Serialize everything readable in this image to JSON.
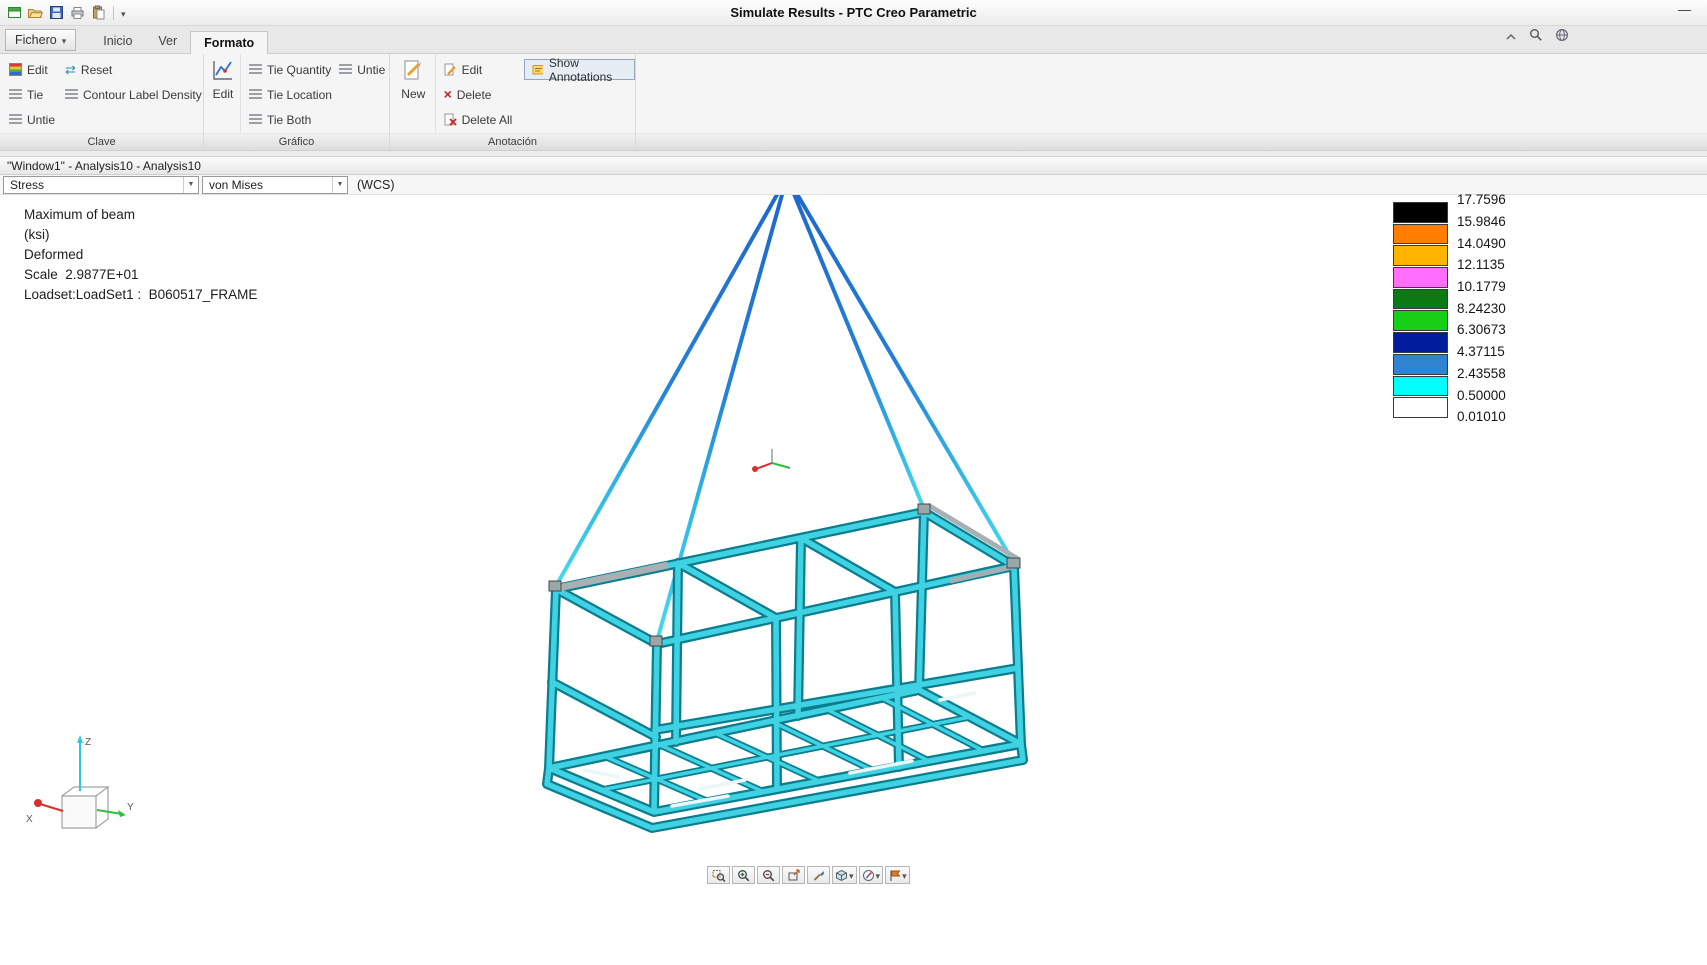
{
  "titlebar": {
    "title": "Simulate Results - PTC Creo Parametric",
    "minimize_glyph": "—"
  },
  "qat": {
    "icons": [
      "window-icon",
      "open-icon",
      "save-icon",
      "print-icon",
      "paste-icon",
      "qat-menu-caret"
    ]
  },
  "ribbon": {
    "file_button": {
      "label": "Fichero"
    },
    "tabs": [
      "Inicio",
      "Ver",
      "Formato"
    ],
    "active_tab": "Formato",
    "right_icons": [
      "collapse-ribbon-icon",
      "search-icon",
      "globe-icon"
    ],
    "groups": {
      "clave": {
        "label": "Clave",
        "edit": "Edit",
        "reset": "Reset",
        "tie": "Tie",
        "contour_label_density": "Contour Label Density",
        "untie": "Untie"
      },
      "grafico": {
        "label": "Gráfico",
        "edit": "Edit",
        "tie_quantity": "Tie Quantity",
        "untie": "Untie",
        "tie_location": "Tie Location",
        "tie_both": "Tie Both"
      },
      "anotacion": {
        "label": "Anotación",
        "new": "New",
        "edit": "Edit",
        "delete": "Delete",
        "delete_all": "Delete All",
        "show_annotations": "Show Annotations"
      }
    }
  },
  "window_header": {
    "title": "\"Window1\" - Analysis10 - Analysis10"
  },
  "results_toolbar": {
    "quantity_combo": "Stress",
    "component_combo": "von Mises",
    "csys_label": "(WCS)"
  },
  "result_info": {
    "lines": [
      "Maximum of beam",
      "(ksi)",
      "Deformed",
      "Scale  2.9877E+01",
      "Loadset:LoadSet1 :  B060517_FRAME"
    ]
  },
  "legend": {
    "boundary_values": [
      "17.7596",
      "15.9846",
      "14.0490",
      "12.1135",
      "10.1779",
      "8.24230",
      "6.30673",
      "4.37115",
      "2.43558",
      "0.50000",
      "0.01010"
    ],
    "band_colors": [
      "#000000",
      "#ff7d00",
      "#ffb400",
      "#ff6eff",
      "#0c7a12",
      "#17cf17",
      "#001b9c",
      "#2f83d0",
      "#00ffff",
      "#ffffff"
    ]
  },
  "csys_triad": {
    "x": "X",
    "y": "Y",
    "z": "Z"
  },
  "bottom_toolbar": {
    "icons": [
      "zoom-window",
      "zoom-in",
      "zoom-out",
      "refit",
      "repaint",
      "display-style",
      "saved-orientations",
      "view-manager"
    ]
  },
  "colors": {
    "cable_blue": "#1c66cc",
    "cable_cyan": "#46d9ef",
    "frame_fill": "#3fd2e2",
    "frame_edge": "#0b7d8f"
  }
}
